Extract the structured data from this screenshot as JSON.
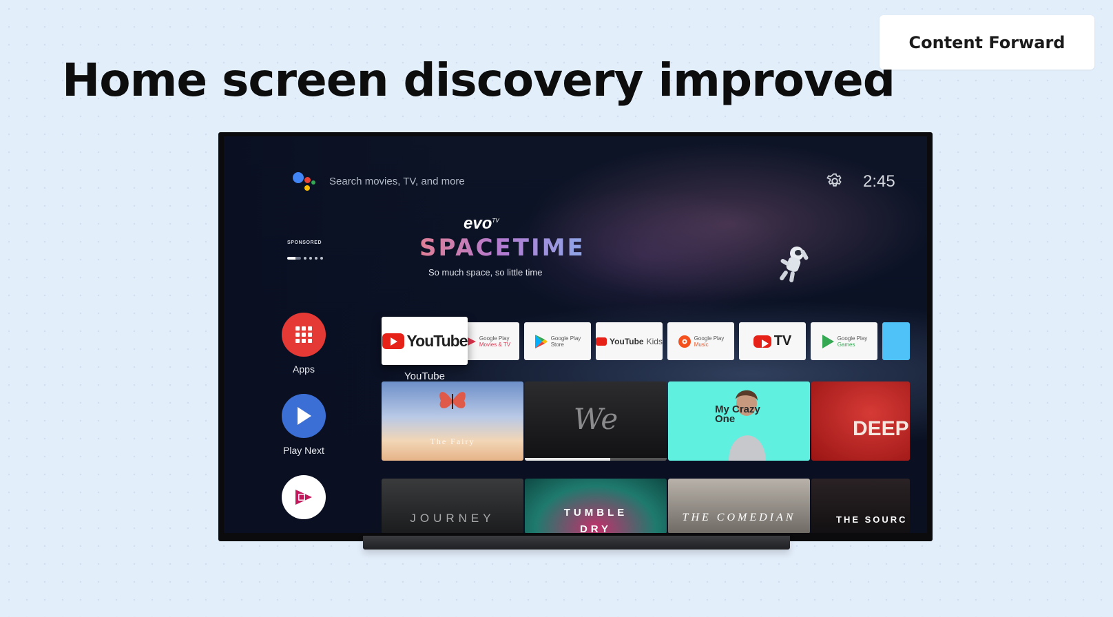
{
  "slide": {
    "title": "Home screen discovery improved",
    "tag": "Content Forward"
  },
  "tv": {
    "search_placeholder": "Search movies, TV, and more",
    "clock": "2:45",
    "sponsored_label": "SPONSORED",
    "promo": {
      "brand": "evo",
      "brand_sup": "TV",
      "title": "SPACETIME",
      "tagline": "So much space, so little time"
    },
    "nav": [
      {
        "label": "Apps",
        "icon": "apps-grid-icon",
        "color": "#e53935"
      },
      {
        "label": "Play Next",
        "icon": "play-icon",
        "color": "#3b6fd6"
      },
      {
        "label": "",
        "icon": "play-movies-icon",
        "color": "#ffffff"
      }
    ],
    "focused_app": {
      "name": "YouTube",
      "caption": "YouTube"
    },
    "apps": [
      {
        "line1": "Google Play",
        "line2": "Movies & TV",
        "accent": "#e0334e"
      },
      {
        "line1": "Google Play",
        "line2": "Store",
        "accent": "#34a853"
      },
      {
        "line1": "YouTube",
        "line2": "Kids",
        "accent": "#e62117"
      },
      {
        "line1": "Google Play",
        "line2": "Music",
        "accent": "#f4511e"
      },
      {
        "line1": "TV",
        "line2": "",
        "accent": "#e62117"
      },
      {
        "line1": "Google Play",
        "line2": "Games",
        "accent": "#34a853"
      }
    ],
    "row1": [
      {
        "title": "The Fairy"
      },
      {
        "title": "We"
      },
      {
        "title": "My Crazy One"
      },
      {
        "title": "DEEP"
      }
    ],
    "row2": [
      {
        "title": "JOURNEY"
      },
      {
        "title": "TUMBLE DRY"
      },
      {
        "title": "THE COMEDIAN"
      },
      {
        "title": "THE SOURC"
      }
    ],
    "colors": {
      "youtube_red": "#e62117",
      "apps_red": "#e53935",
      "play_next_blue": "#3b6fd6"
    }
  }
}
